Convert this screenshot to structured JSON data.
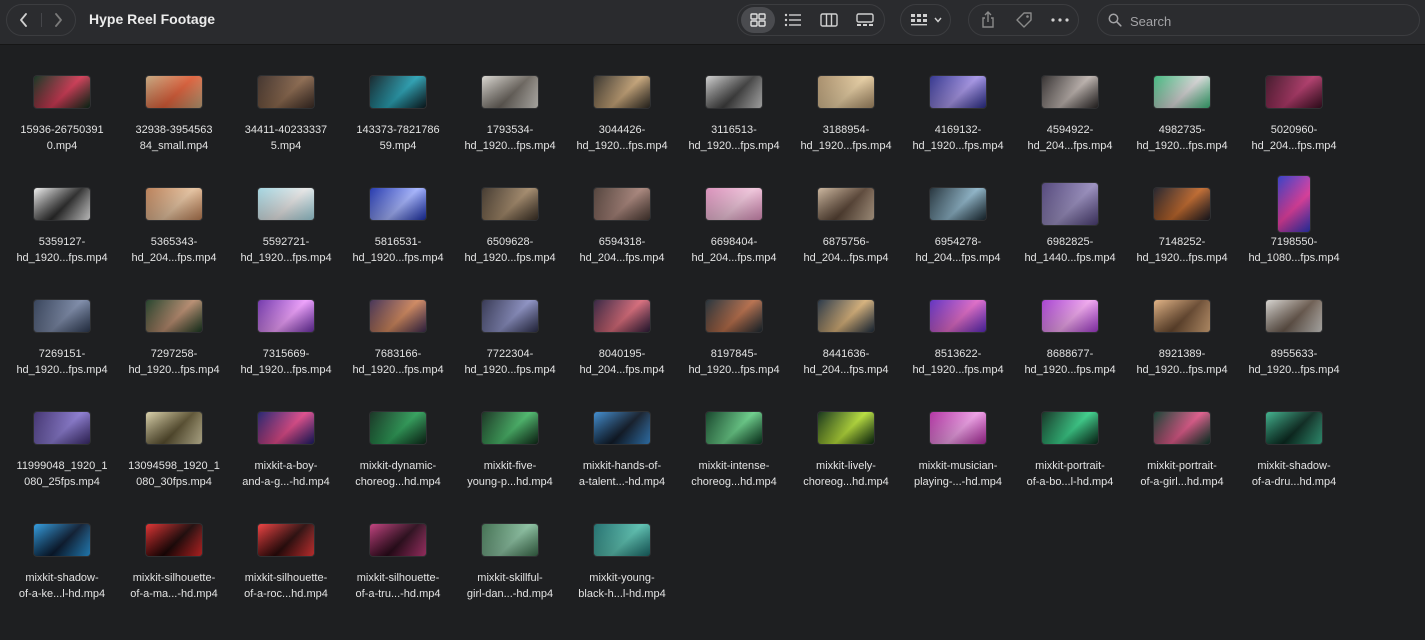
{
  "window": {
    "title": "Hype Reel Footage"
  },
  "search": {
    "placeholder": "Search"
  },
  "toolbar": {
    "view_icons": [
      "icon-view-icon",
      "list-view-icon",
      "column-view-icon",
      "gallery-view-icon"
    ],
    "active_view": "icon-view-icon"
  },
  "files": [
    {
      "line1": "15936-26750391",
      "line2": "0.mp4",
      "c1": "#0b2e1a",
      "c2": "#d23a55"
    },
    {
      "line1": "32938-3954563",
      "line2": "84_small.mp4",
      "c1": "#c3a57c",
      "c2": "#e0603a"
    },
    {
      "line1": "34411-40233337",
      "line2": "5.mp4",
      "c1": "#3a2b25",
      "c2": "#8d6a4f"
    },
    {
      "line1": "143373-7821786",
      "line2": "59.mp4",
      "c1": "#0d1c22",
      "c2": "#2aa3b6"
    },
    {
      "line1": "1793534-",
      "line2": "hd_1920...fps.mp4",
      "c1": "#d9d6d0",
      "c2": "#6d6760"
    },
    {
      "line1": "3044426-",
      "line2": "hd_1920...fps.mp4",
      "c1": "#2e2a24",
      "c2": "#c9a77a"
    },
    {
      "line1": "3116513-",
      "line2": "hd_1920...fps.mp4",
      "c1": "#cfcfcf",
      "c2": "#404040"
    },
    {
      "line1": "3188954-",
      "line2": "hd_1920...fps.mp4",
      "c1": "#a58a66",
      "c2": "#e8cfa3"
    },
    {
      "line1": "4169132-",
      "line2": "hd_1920...fps.mp4",
      "c1": "#2a2d8a",
      "c2": "#a796e8"
    },
    {
      "line1": "4594922-",
      "line2": "hd_204...fps.mp4",
      "c1": "#2a2626",
      "c2": "#bfb5b0"
    },
    {
      "line1": "4982735-",
      "line2": "hd_1920...fps.mp4",
      "c1": "#3bb67a",
      "c2": "#d8d8d8"
    },
    {
      "line1": "5020960-",
      "line2": "hd_204...fps.mp4",
      "c1": "#3a0f22",
      "c2": "#b33a6b"
    },
    {
      "line1": "5359127-",
      "line2": "hd_1920...fps.mp4",
      "c1": "#f0f0f0",
      "c2": "#2b2b2b"
    },
    {
      "line1": "5365343-",
      "line2": "hd_204...fps.mp4",
      "c1": "#b87b52",
      "c2": "#e6c3a0"
    },
    {
      "line1": "5592721-",
      "line2": "hd_1920...fps.mp4",
      "c1": "#9fd3df",
      "c2": "#e7e7e7"
    },
    {
      "line1": "5816531-",
      "line2": "hd_1920...fps.mp4",
      "c1": "#1a2faa",
      "c2": "#a5b4ff"
    },
    {
      "line1": "6509628-",
      "line2": "hd_1920...fps.mp4",
      "c1": "#3a3026",
      "c2": "#a48a6b"
    },
    {
      "line1": "6594318-",
      "line2": "hd_204...fps.mp4",
      "c1": "#4a3a33",
      "c2": "#a8847a"
    },
    {
      "line1": "6698404-",
      "line2": "hd_204...fps.mp4",
      "c1": "#d98db9",
      "c2": "#f1c6dc"
    },
    {
      "line1": "6875756-",
      "line2": "hd_204...fps.mp4",
      "c1": "#c9b39a",
      "c2": "#5a4536"
    },
    {
      "line1": "6954278-",
      "line2": "hd_204...fps.mp4",
      "c1": "#1b2a33",
      "c2": "#8eb5c9"
    },
    {
      "line1": "6982825-",
      "line2": "hd_1440...fps.mp4",
      "c1": "#4c3f76",
      "c2": "#9a8fc0",
      "shape": "square"
    },
    {
      "line1": "7148252-",
      "line2": "hd_1920...fps.mp4",
      "c1": "#1a1a24",
      "c2": "#c36a2d"
    },
    {
      "line1": "7198550-",
      "line2": "hd_1080...fps.mp4",
      "c1": "#2c38c4",
      "c2": "#e83ea3",
      "shape": "portrait"
    },
    {
      "line1": "7269151-",
      "line2": "hd_1920...fps.mp4",
      "c1": "#2d3a52",
      "c2": "#7c8aa8"
    },
    {
      "line1": "7297258-",
      "line2": "hd_1920...fps.mp4",
      "c1": "#1a3a22",
      "c2": "#b88c6f"
    },
    {
      "line1": "7315669-",
      "line2": "hd_1920...fps.mp4",
      "c1": "#6b2fa8",
      "c2": "#f0a0ff"
    },
    {
      "line1": "7683166-",
      "line2": "hd_1920...fps.mp4",
      "c1": "#3c2a50",
      "c2": "#d1885e"
    },
    {
      "line1": "7722304-",
      "line2": "hd_1920...fps.mp4",
      "c1": "#2c2e4a",
      "c2": "#8c91c4"
    },
    {
      "line1": "8040195-",
      "line2": "hd_204...fps.mp4",
      "c1": "#2c1c3a",
      "c2": "#d96b7a"
    },
    {
      "line1": "8197845-",
      "line2": "hd_1920...fps.mp4",
      "c1": "#1c2a33",
      "c2": "#b86e4a"
    },
    {
      "line1": "8441636-",
      "line2": "hd_204...fps.mp4",
      "c1": "#1e2e40",
      "c2": "#d8b27a"
    },
    {
      "line1": "8513622-",
      "line2": "hd_1920...fps.mp4",
      "c1": "#5a2ac0",
      "c2": "#e06ac8"
    },
    {
      "line1": "8688677-",
      "line2": "hd_1920...fps.mp4",
      "c1": "#a33ad0",
      "c2": "#f2a8f0"
    },
    {
      "line1": "8921389-",
      "line2": "hd_1920...fps.mp4",
      "c1": "#e0b080",
      "c2": "#6a4a30"
    },
    {
      "line1": "8955633-",
      "line2": "hd_1920...fps.mp4",
      "c1": "#d5d3cf",
      "c2": "#6a5a4e"
    },
    {
      "line1": "11999048_1920_1",
      "line2": "080_25fps.mp4",
      "c1": "#3a2a6a",
      "c2": "#8a7ad0"
    },
    {
      "line1": "13094598_1920_1",
      "line2": "080_30fps.mp4",
      "c1": "#d9d0a8",
      "c2": "#5a5030"
    },
    {
      "line1": "mixkit-a-boy-",
      "line2": "and-a-g...-hd.mp4",
      "c1": "#1a1c6a",
      "c2": "#e04a8a"
    },
    {
      "line1": "mixkit-dynamic-",
      "line2": "choreog...hd.mp4",
      "c1": "#0e2a1a",
      "c2": "#2fa05a"
    },
    {
      "line1": "mixkit-five-",
      "line2": "young-p...hd.mp4",
      "c1": "#0f2a18",
      "c2": "#4ab86a"
    },
    {
      "line1": "mixkit-hands-of-",
      "line2": "a-talent...-hd.mp4",
      "c1": "#3a8ad0",
      "c2": "#101a28"
    },
    {
      "line1": "mixkit-intense-",
      "line2": "choreog...hd.mp4",
      "c1": "#0a3a20",
      "c2": "#6ad08a"
    },
    {
      "line1": "mixkit-lively-",
      "line2": "choreog...hd.mp4",
      "c1": "#0a2a10",
      "c2": "#b8e03a"
    },
    {
      "line1": "mixkit-musician-",
      "line2": "playing-...-hd.mp4",
      "c1": "#b02aa0",
      "c2": "#f0a0e8"
    },
    {
      "line1": "mixkit-portrait-",
      "line2": "of-a-bo...l-hd.mp4",
      "c1": "#0a2a1a",
      "c2": "#3ad08a"
    },
    {
      "line1": "mixkit-portrait-",
      "line2": "of-a-girl...hd.mp4",
      "c1": "#0a3a2a",
      "c2": "#e05a8a"
    },
    {
      "line1": "mixkit-shadow-",
      "line2": "of-a-dru...hd.mp4",
      "c1": "#3ab08a",
      "c2": "#0a2a20"
    },
    {
      "line1": "mixkit-shadow-",
      "line2": "of-a-ke...l-hd.mp4",
      "c1": "#2a9ae0",
      "c2": "#0a1a30"
    },
    {
      "line1": "mixkit-silhouette-",
      "line2": "of-a-ma...-hd.mp4",
      "c1": "#e02a2a",
      "c2": "#1a0505"
    },
    {
      "line1": "mixkit-silhouette-",
      "line2": "of-a-roc...hd.mp4",
      "c1": "#f03a3a",
      "c2": "#2a0a0a"
    },
    {
      "line1": "mixkit-silhouette-",
      "line2": "of-a-tru...-hd.mp4",
      "c1": "#c03a7a",
      "c2": "#2a0a1a"
    },
    {
      "line1": "mixkit-skillful-",
      "line2": "girl-dan...-hd.mp4",
      "c1": "#3a6a4a",
      "c2": "#8ac0a0"
    },
    {
      "line1": "mixkit-young-",
      "line2": "black-h...l-hd.mp4",
      "c1": "#1a6a6a",
      "c2": "#5ac0b0"
    }
  ]
}
